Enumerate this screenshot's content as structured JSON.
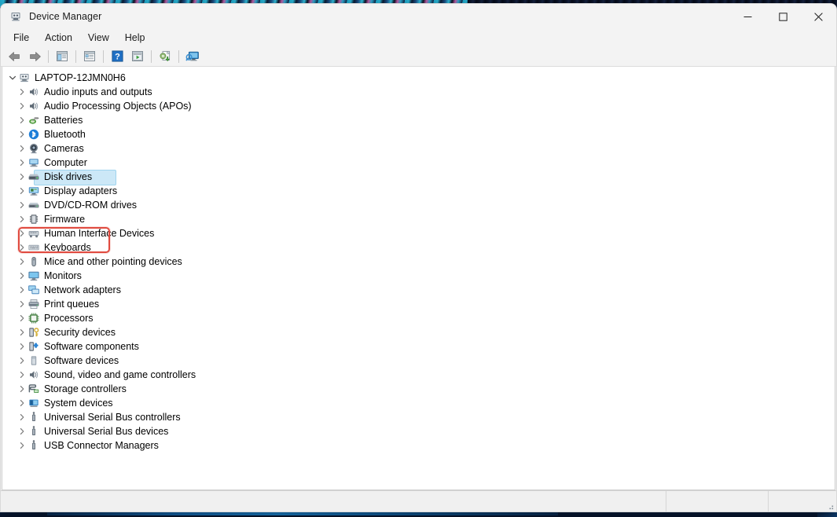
{
  "window": {
    "title": "Device Manager",
    "title_icon": "device-manager-icon",
    "controls": {
      "minimize": "Minimize",
      "maximize": "Maximize",
      "close": "Close"
    }
  },
  "menubar": {
    "items": [
      {
        "label": "File",
        "name": "menu-file"
      },
      {
        "label": "Action",
        "name": "menu-action"
      },
      {
        "label": "View",
        "name": "menu-view"
      },
      {
        "label": "Help",
        "name": "menu-help"
      }
    ]
  },
  "toolbar": {
    "buttons": [
      {
        "name": "back-button",
        "icon": "back-arrow-icon",
        "tooltip": "Back"
      },
      {
        "name": "forward-button",
        "icon": "forward-arrow-icon",
        "tooltip": "Forward"
      },
      {
        "name": "show-hide-console-tree-button",
        "icon": "console-tree-icon",
        "tooltip": "Show/Hide Console Tree"
      },
      {
        "name": "properties-button",
        "icon": "properties-icon",
        "tooltip": "Properties"
      },
      {
        "name": "help-button",
        "icon": "help-question-icon",
        "tooltip": "Help"
      },
      {
        "name": "update-driver-button",
        "icon": "update-driver-icon",
        "tooltip": "Update Driver"
      },
      {
        "name": "scan-hardware-changes-button",
        "icon": "scan-hardware-icon",
        "tooltip": "Scan for hardware changes"
      },
      {
        "name": "devices-by-connection-button",
        "icon": "monitor-scan-icon",
        "tooltip": "Devices by connection"
      }
    ]
  },
  "tree": {
    "root": {
      "label": "LAPTOP-12JMN0H6",
      "icon": "computer-icon",
      "expanded": true
    },
    "nodes": [
      {
        "label": "Audio inputs and outputs",
        "icon": "speaker-icon",
        "selected": false
      },
      {
        "label": "Audio Processing Objects (APOs)",
        "icon": "speaker-icon",
        "selected": false
      },
      {
        "label": "Batteries",
        "icon": "battery-icon",
        "selected": false
      },
      {
        "label": "Bluetooth",
        "icon": "bluetooth-icon",
        "selected": false
      },
      {
        "label": "Cameras",
        "icon": "camera-icon",
        "selected": false
      },
      {
        "label": "Computer",
        "icon": "computer-node-icon",
        "selected": false
      },
      {
        "label": "Disk drives",
        "icon": "disk-drive-icon",
        "selected": true
      },
      {
        "label": "Display adapters",
        "icon": "display-adapter-icon",
        "selected": false
      },
      {
        "label": "DVD/CD-ROM drives",
        "icon": "dvd-drive-icon",
        "selected": false
      },
      {
        "label": "Firmware",
        "icon": "firmware-chip-icon",
        "selected": false
      },
      {
        "label": "Human Interface Devices",
        "icon": "hid-icon",
        "selected": false
      },
      {
        "label": "Keyboards",
        "icon": "keyboard-icon",
        "selected": false
      },
      {
        "label": "Mice and other pointing devices",
        "icon": "mouse-icon",
        "selected": false
      },
      {
        "label": "Monitors",
        "icon": "monitor-icon",
        "selected": false
      },
      {
        "label": "Network adapters",
        "icon": "network-adapter-icon",
        "selected": false
      },
      {
        "label": "Print queues",
        "icon": "printer-icon",
        "selected": false
      },
      {
        "label": "Processors",
        "icon": "processor-icon",
        "selected": false
      },
      {
        "label": "Security devices",
        "icon": "security-key-icon",
        "selected": false
      },
      {
        "label": "Software components",
        "icon": "software-component-icon",
        "selected": false
      },
      {
        "label": "Software devices",
        "icon": "software-device-icon",
        "selected": false
      },
      {
        "label": "Sound, video and game controllers",
        "icon": "sound-controller-icon",
        "selected": false
      },
      {
        "label": "Storage controllers",
        "icon": "storage-controller-icon",
        "selected": false
      },
      {
        "label": "System devices",
        "icon": "system-device-icon",
        "selected": false
      },
      {
        "label": "Universal Serial Bus controllers",
        "icon": "usb-icon",
        "selected": false
      },
      {
        "label": "Universal Serial Bus devices",
        "icon": "usb-icon",
        "selected": false
      },
      {
        "label": "USB Connector Managers",
        "icon": "usb-icon",
        "selected": false
      }
    ]
  },
  "annotation": {
    "highlight_color": "#e04a3f",
    "target_label": "Disk drives"
  },
  "statusbar": {
    "pane1": "",
    "pane2": "",
    "pane3": ""
  },
  "colors": {
    "selection": "#cce8f7",
    "window_chrome": "#f3f3f3",
    "tree_background": "#ffffff"
  }
}
